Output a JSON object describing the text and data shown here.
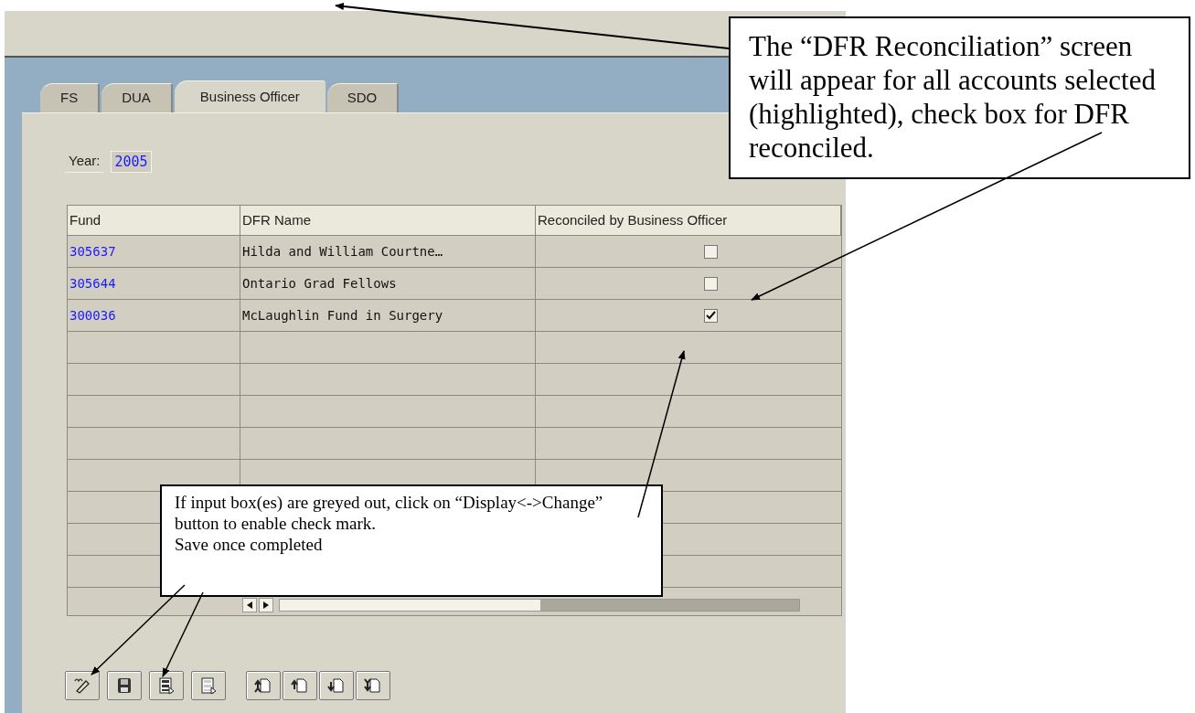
{
  "tabs": [
    {
      "label": "FS",
      "selected": false
    },
    {
      "label": "DUA",
      "selected": false
    },
    {
      "label": "Business Officer",
      "selected": true
    },
    {
      "label": "SDO",
      "selected": false
    }
  ],
  "year": {
    "label": "Year:",
    "value": "2005"
  },
  "table": {
    "columns": [
      "Fund",
      "DFR Name",
      "Reconciled by Business Officer"
    ],
    "rows": [
      {
        "fund": "305637",
        "name": "Hilda and William Courtne…",
        "reconciled": false
      },
      {
        "fund": "305644",
        "name": "Ontario Grad Fellows",
        "reconciled": false
      },
      {
        "fund": "300036",
        "name": "McLaughlin Fund in Surgery",
        "reconciled": true
      }
    ]
  },
  "toolbar": [
    {
      "kind": "edit"
    },
    {
      "kind": "save"
    },
    {
      "kind": "select_all"
    },
    {
      "kind": "deselect_all"
    },
    {
      "kind": "first"
    },
    {
      "kind": "previous"
    },
    {
      "kind": "next"
    },
    {
      "kind": "last"
    }
  ],
  "annotations": [
    {
      "lines": [
        "The “DFR Reconciliation” screen will appear for all accounts selected (highlighted), check box for DFR reconciled."
      ]
    },
    {
      "lines": [
        "If input box(es) are greyed out, click on “Display<->Change” button to enable check mark.",
        "Save once completed"
      ]
    }
  ]
}
